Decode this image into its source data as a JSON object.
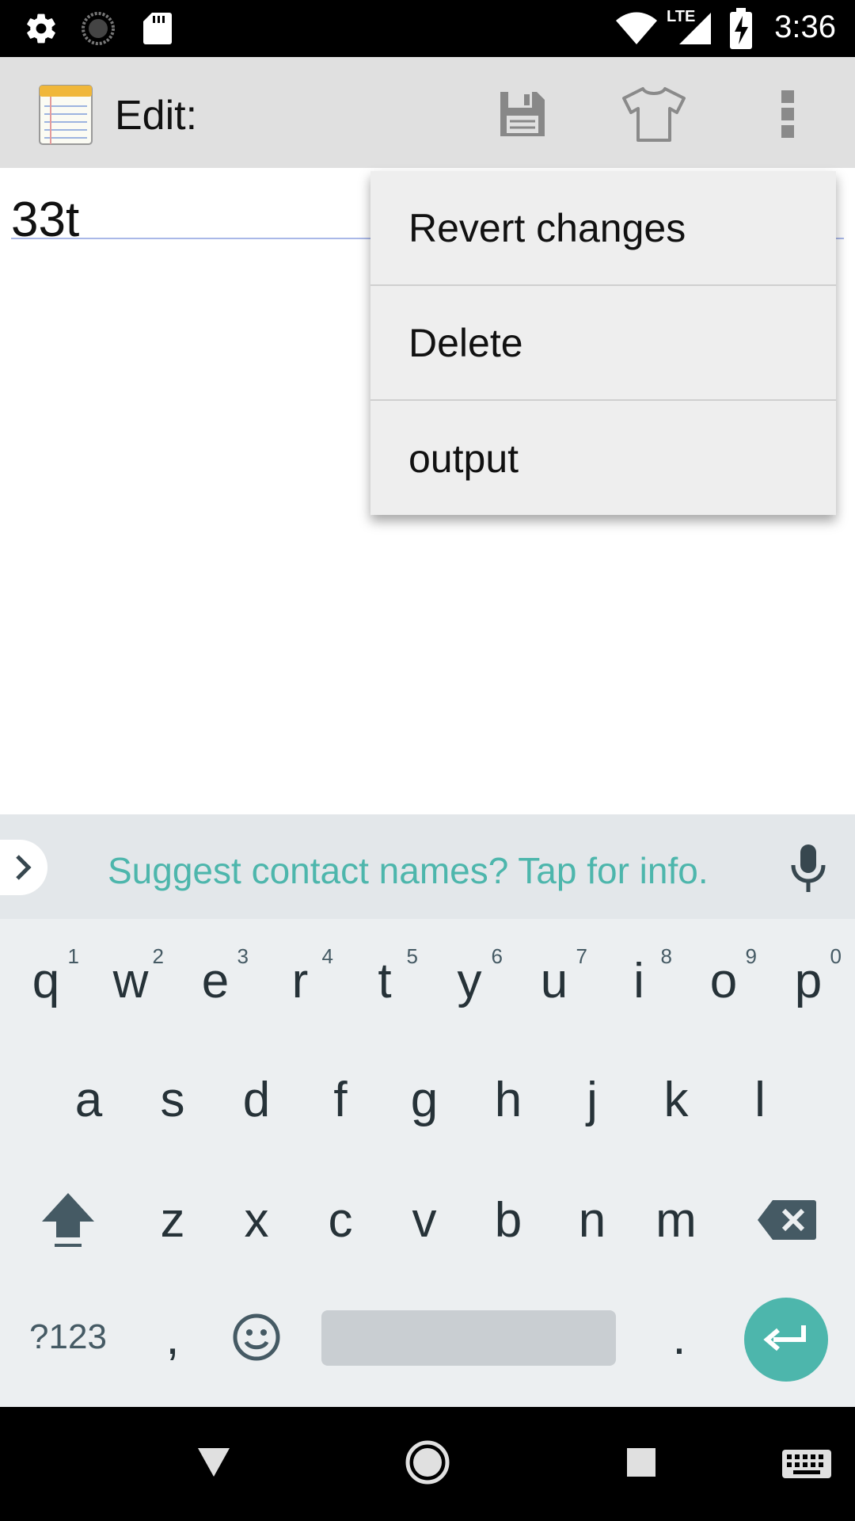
{
  "status_bar": {
    "time": "3:36",
    "icons": [
      "settings-icon",
      "sync-icon",
      "sd-card-icon",
      "wifi-icon",
      "lte-signal-icon",
      "battery-charging-icon"
    ],
    "network_label": "LTE"
  },
  "app_bar": {
    "title": "Edit:",
    "actions": [
      "save-icon",
      "theme-icon",
      "overflow-menu-icon"
    ]
  },
  "editor": {
    "content": "33t"
  },
  "popup_menu": {
    "items": [
      "Revert changes",
      "Delete",
      "output"
    ]
  },
  "keyboard": {
    "suggestion_text": "Suggest contact names? Tap for info.",
    "row1": [
      {
        "key": "q",
        "hint": "1"
      },
      {
        "key": "w",
        "hint": "2"
      },
      {
        "key": "e",
        "hint": "3"
      },
      {
        "key": "r",
        "hint": "4"
      },
      {
        "key": "t",
        "hint": "5"
      },
      {
        "key": "y",
        "hint": "6"
      },
      {
        "key": "u",
        "hint": "7"
      },
      {
        "key": "i",
        "hint": "8"
      },
      {
        "key": "o",
        "hint": "9"
      },
      {
        "key": "p",
        "hint": "0"
      }
    ],
    "row2": [
      "a",
      "s",
      "d",
      "f",
      "g",
      "h",
      "j",
      "k",
      "l"
    ],
    "row3": [
      "z",
      "x",
      "c",
      "v",
      "b",
      "n",
      "m"
    ],
    "symbols_label": "?123",
    "comma": ",",
    "period": ".",
    "accent_color": "#4db6ac"
  },
  "nav_bar": {
    "icons": [
      "back-icon",
      "home-icon",
      "recents-icon",
      "keyboard-switch-icon"
    ]
  }
}
